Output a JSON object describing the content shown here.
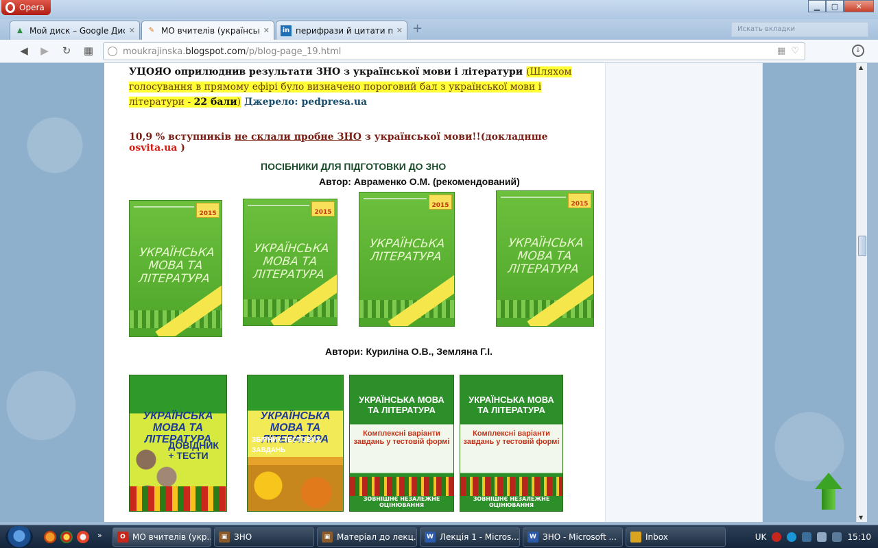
{
  "window": {
    "app_button": "Opera",
    "controls": [
      "minimize",
      "maximize",
      "close"
    ]
  },
  "tabs": [
    {
      "label": "Мой диск – Google Диск",
      "icon": "google-drive-icon",
      "active": false
    },
    {
      "label": "МО вчителів (українська, ",
      "icon": "blogger-icon",
      "active": true
    },
    {
      "label": "перифрази й цитати про ",
      "icon": "linkedin-icon",
      "active": false
    }
  ],
  "tab_search_placeholder": "Искать вкладки",
  "address": {
    "prefix": "moukrajinska.",
    "host": "blogspot.com",
    "path": "/p/blog-page_19.html"
  },
  "content": {
    "p1_bold": "УЦОЯО оприлюднив результати ЗНО з української мови і літератури ",
    "p1_highlight": "(Шляхом голосування в прямому ефірі було визначено пороговий бал з української мови і літератури - ",
    "p1_highlight_bold": "22 бали",
    "p1_highlight_end": ")",
    "p1_source_label": " Джерело: ",
    "p1_source": "pedpresa.ua",
    "p2_start": "10,9 % вступників ",
    "p2_underline": "не склали пробне ЗНО",
    "p2_mid": " з української мови!!(докладнше ",
    "p2_link": "osvita.ua",
    "p2_end": " )",
    "section_title": "ПОСІБНИКИ ДЛЯ ПІДГОТОВКИ ДО ЗНО",
    "author1": "Автор: Авраменко О.М. (рекомендований)",
    "author2": "Автори: Куриліна О.В., Земляна Г.І."
  },
  "books_row1": [
    {
      "title": "УКРАЇНСЬКА МОВА ТА ЛІТЕРАТУРА",
      "badge": "2015"
    },
    {
      "title": "УКРАЇНСЬКА МОВА ТА ЛІТЕРАТУРА",
      "badge": "2015"
    },
    {
      "title": "УКРАЇНСЬКА ЛІТЕРАТУРА",
      "badge": "2015"
    },
    {
      "title": "УКРАЇНСЬКА МОВА ТА ЛІТЕРАТУРА",
      "badge": "2015"
    }
  ],
  "books_row2": [
    {
      "title": "УКРАЇНСЬКА МОВА ТА ЛІТЕРАТУРА",
      "subtitle": "ДОВІДНИК + ТЕСТИ"
    },
    {
      "title": "УКРАЇНСЬКА МОВА ТА ЛІТЕРАТУРА",
      "subtitle": "ЗБІРНИК ТЕСТОВИХ ЗАВДАНЬ"
    },
    {
      "title": "УКРАЇНСЬКА МОВА ТА ЛІТЕРАТУРА",
      "subtitle": "Комплексні варіанти завдань у тестовій формі",
      "footer": "ЗОВНІШНЄ НЕЗАЛЕЖНЕ ОЦІНЮВАННЯ"
    },
    {
      "title": "УКРАЇНСЬКА МОВА ТА ЛІТЕРАТУРА",
      "subtitle": "Комплексні варіанти завдань у тестовій формі",
      "footer": "ЗОВНІШНЄ НЕЗАЛЕЖНЕ ОЦІНЮВАННЯ"
    }
  ],
  "taskbar": {
    "buttons": [
      {
        "label": "МО вчителів (укр...",
        "icon": "opera-icon",
        "color": "#c7261c"
      },
      {
        "label": "ЗНО",
        "icon": "image-viewer-icon",
        "color": "#8a5a2a"
      },
      {
        "label": "Матеріал до лекц...",
        "icon": "image-viewer-icon",
        "color": "#8a5a2a"
      },
      {
        "label": "Лекція 1 - Micros...",
        "icon": "word-icon",
        "color": "#2b5aa8"
      },
      {
        "label": "ЗНО - Microsoft ...",
        "icon": "word-icon",
        "color": "#2b5aa8"
      },
      {
        "label": "Inbox",
        "icon": "folder-icon",
        "color": "#d9a520"
      }
    ],
    "language": "UK",
    "time": "15:10"
  }
}
